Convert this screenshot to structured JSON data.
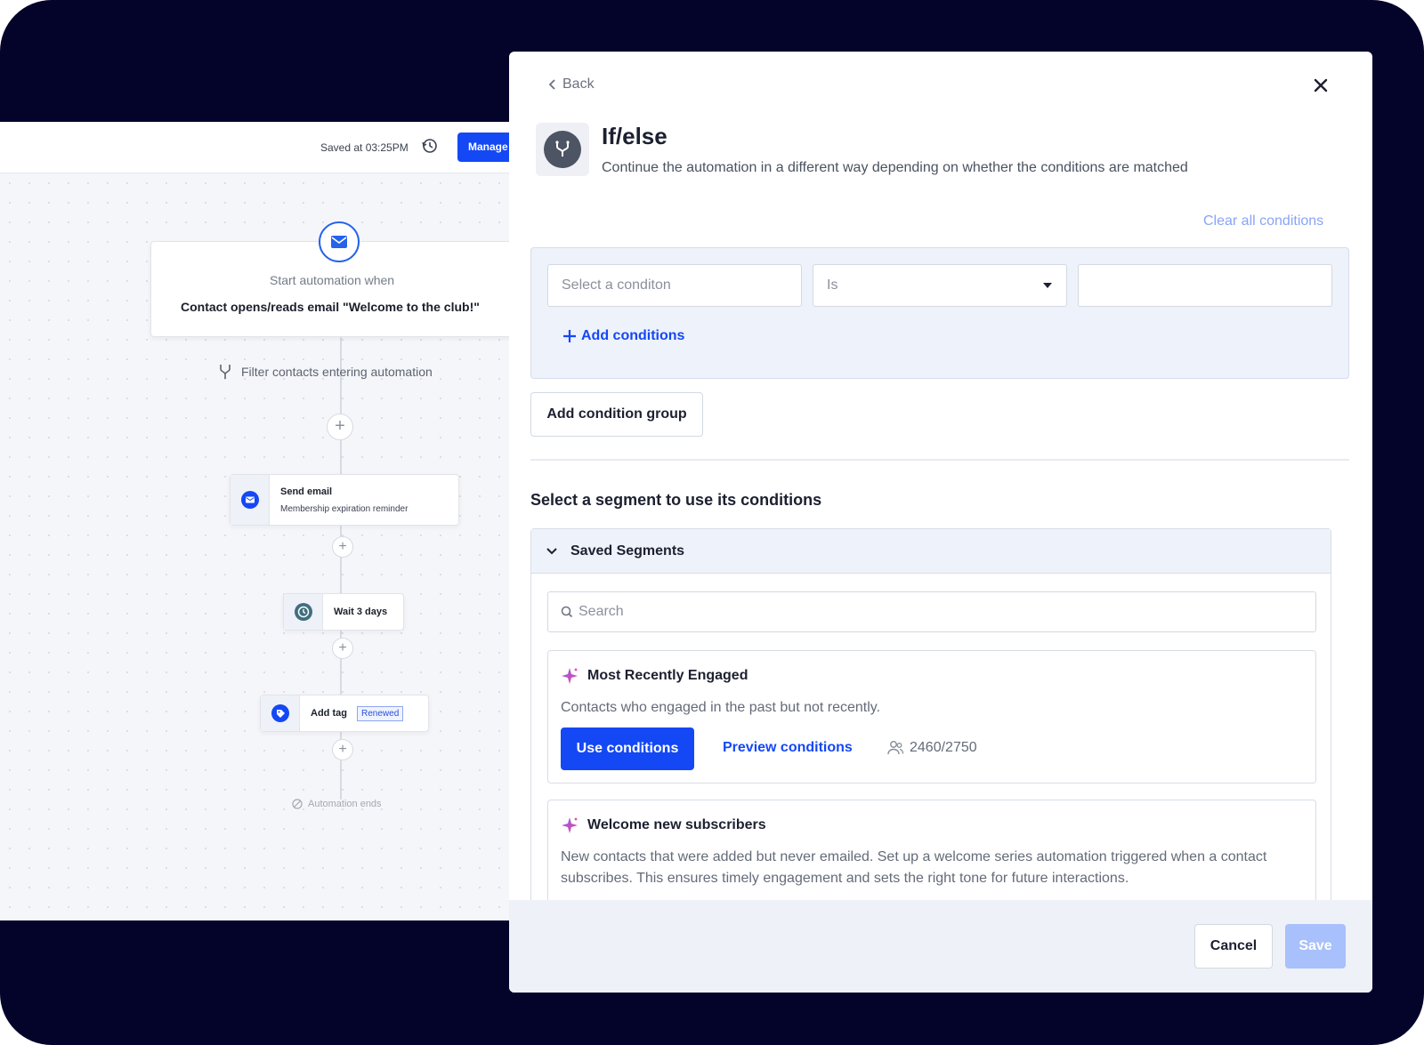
{
  "colors": {
    "frame_bg": "#04032a",
    "accent": "#1448f5",
    "accent_light": "#8aa3f6",
    "save_disabled": "#a8c0fb"
  },
  "canvas": {
    "saved_text": "Saved at 03:25PM",
    "history_icon": "history-icon",
    "manage_label": "Manage",
    "trigger": {
      "icon": "envelope-icon",
      "subtitle": "Start automation when",
      "title": "Contact opens/reads email \"Welcome to the club!\""
    },
    "filter": {
      "icon": "branch-filter-icon",
      "label": "Filter contacts entering automation"
    },
    "steps": [
      {
        "icon": "email-icon",
        "title": "Send email",
        "subtitle": "Membership expiration reminder"
      },
      {
        "icon": "clock-icon",
        "title": "Wait 3 days"
      },
      {
        "icon": "tag-icon",
        "title": "Add tag",
        "badge": "Renewed"
      }
    ],
    "end_label": "Automation ends"
  },
  "modal": {
    "back_label": "Back",
    "close_icon": "close-icon",
    "icon": "if-else-branch-icon",
    "title": "If/else",
    "description": "Continue the automation in a different way depending on whether the conditions are matched",
    "clear_all_label": "Clear all conditions",
    "condition": {
      "field_placeholder": "Select a conditon",
      "operator_value": "Is",
      "value": ""
    },
    "add_conditions_label": "Add conditions",
    "add_group_label": "Add condition group",
    "segment_heading": "Select a segment to use its conditions",
    "saved_segments_label": "Saved Segments",
    "search_placeholder": "Search",
    "segments": [
      {
        "icon": "sparkle-icon",
        "title": "Most Recently Engaged",
        "description": "Contacts who engaged in the past but not recently.",
        "use_label": "Use conditions",
        "preview_label": "Preview conditions",
        "count": "2460/2750"
      },
      {
        "icon": "sparkle-icon",
        "title": "Welcome new subscribers",
        "description": "New contacts that were added but never emailed. Set up a welcome series automation triggered when a contact subscribes. This ensures timely engagement and sets the right tone for future interactions."
      }
    ],
    "cancel_label": "Cancel",
    "save_label": "Save"
  }
}
